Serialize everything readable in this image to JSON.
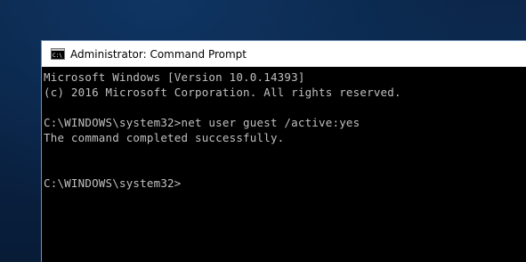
{
  "window": {
    "title": "Administrator: Command Prompt",
    "icon": "cmd-icon"
  },
  "console": {
    "lines": [
      "Microsoft Windows [Version 10.0.14393]",
      "(c) 2016 Microsoft Corporation. All rights reserved.",
      "",
      "C:\\WINDOWS\\system32>net user guest /active:yes",
      "The command completed successfully.",
      "",
      "",
      "C:\\WINDOWS\\system32>"
    ]
  },
  "colors": {
    "console_background": "#000000",
    "console_text": "#c0c0c0",
    "titlebar_background": "#ffffff",
    "desktop_background": "#0b2547"
  }
}
